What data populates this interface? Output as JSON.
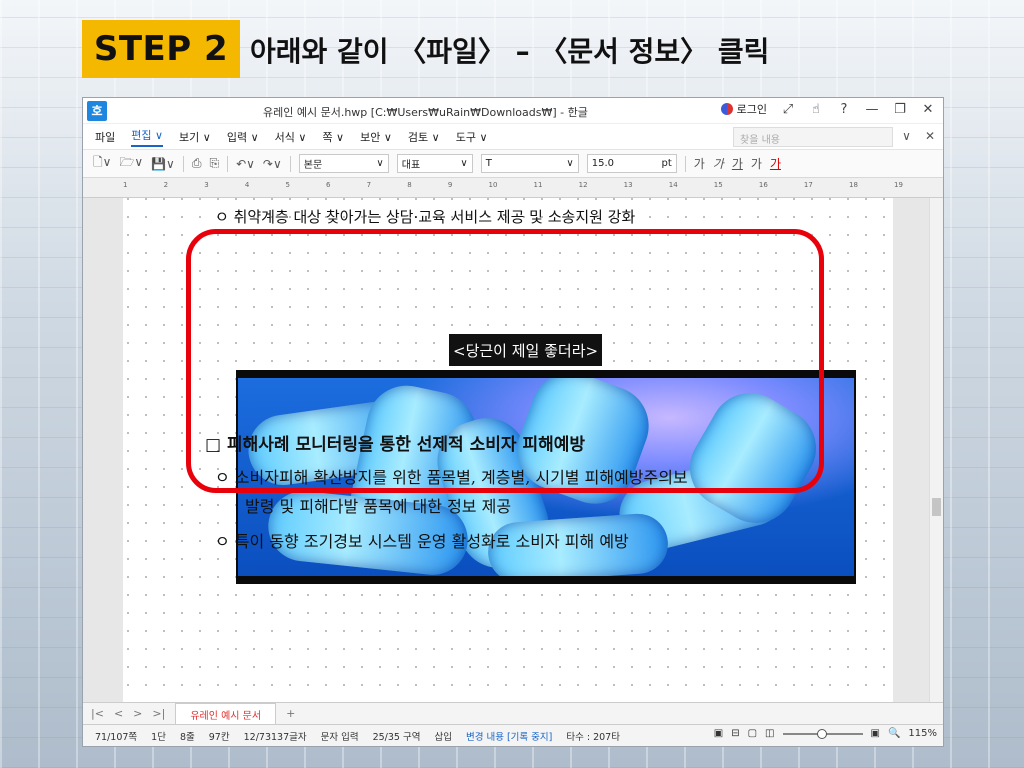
{
  "step": {
    "badge": "STEP 2",
    "title": "아래와 같이 〈파일〉 – 〈문서 정보〉 클릭"
  },
  "window": {
    "app_icon": "호",
    "title": "유레인 예시 문서.hwp [C:₩Users₩uRain₩Downloads₩] - 한글",
    "login": "로그인",
    "title_buttons": [
      "⤢",
      "☝",
      "?",
      "—",
      "❐",
      "✕"
    ]
  },
  "menu": {
    "items": [
      "파일",
      "편집 ∨",
      "보기 ∨",
      "입력 ∨",
      "서식 ∨",
      "쪽 ∨",
      "보안 ∨",
      "검토 ∨",
      "도구 ∨"
    ],
    "find_placeholder": "찾을 내용",
    "right_icons": [
      "∨",
      "✕"
    ]
  },
  "toolbar": {
    "style_select": "본문",
    "font_select": "대표",
    "font_name_select": "T",
    "font_size": "15.0",
    "unit": "pt",
    "format_buttons": [
      "가",
      "가",
      "가",
      "가",
      "가"
    ]
  },
  "ruler": {
    "ticks": [
      "1",
      "2",
      "3",
      "4",
      "5",
      "6",
      "7",
      "8",
      "9",
      "10",
      "11",
      "12",
      "13",
      "14",
      "15",
      "16",
      "17",
      "18",
      "19"
    ]
  },
  "document": {
    "line_top": "ㅇ 취약계층 대상 찾아가는 상담·교육 서비스 제공 및 소송지원 강화",
    "caption": "<당근이 제일 좋더라>",
    "heading": "□ 피해사례 모니터링을 통한 선제적 소비자 피해예방",
    "bullet1_line1": "ㅇ 소비자피해 확산방지를 위한 품목별, 계층별, 시기별 피해예방주의보",
    "bullet1_line2": "발령 및 피해다발 품목에 대한 정보 제공",
    "bullet2": "ㅇ 특이 동향 조기경보 시스템 운영 활성화로 소비자 피해 예방"
  },
  "tabs": {
    "nav": [
      "|<",
      "<",
      ">",
      ">|"
    ],
    "doc_tab": "유레인 예시 문서",
    "add": "+"
  },
  "status": {
    "page": "71/107쪽",
    "column": "1단",
    "line": "8줄",
    "col": "97칸",
    "chars": "12/73137글자",
    "input_mode": "문자 입력",
    "section": "25/35 구역",
    "insert": "삽입",
    "track_changes": "변경 내용 [기록 중지]",
    "taps": "타수 : 207타",
    "zoom": "115%"
  },
  "colors": {
    "step_badge": "#f5b800",
    "highlight": "#e8000b",
    "accent": "#1864c8"
  }
}
